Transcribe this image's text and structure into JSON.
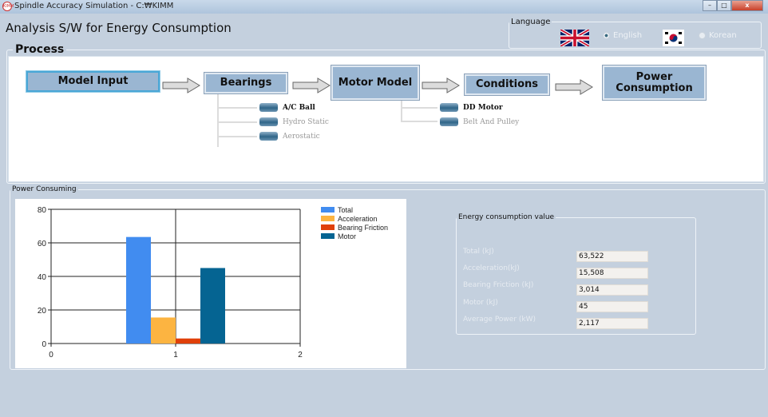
{
  "window": {
    "title": "Spindle Accuracy Simulation -  C:₩KIMM",
    "icon_text": "KIMM",
    "controls": [
      "minimize",
      "maximize",
      "close"
    ],
    "close_label": "x"
  },
  "heading": "Analysis S/W for Energy Consumption",
  "language": {
    "label": "Language",
    "options": [
      {
        "label": "English",
        "selected": true,
        "flag": "uk-flag"
      },
      {
        "label": "Korean",
        "selected": false,
        "flag": "korea-flag"
      }
    ]
  },
  "process": {
    "label": "Process",
    "steps": [
      "Model Input",
      "Bearings",
      "Motor Model",
      "Conditions",
      "Power Consumption"
    ],
    "bearing_options": [
      {
        "label": "A/C Ball",
        "active": true
      },
      {
        "label": "Hydro Static",
        "active": false
      },
      {
        "label": "Aerostatic",
        "active": false
      }
    ],
    "motor_options": [
      {
        "label": "DD Motor",
        "active": true
      },
      {
        "label": "Belt And Pulley",
        "active": false
      }
    ]
  },
  "power": {
    "label": "Power Consuming"
  },
  "chart_data": {
    "type": "bar",
    "x": [
      1
    ],
    "xlim": [
      0,
      2
    ],
    "ylim": [
      0,
      80
    ],
    "xticks": [
      "0",
      "1",
      "2"
    ],
    "yticks": [
      "0",
      "20",
      "40",
      "60",
      "80"
    ],
    "grid": true,
    "legend_position": "right",
    "series": [
      {
        "name": "Total",
        "values": [
          63.5
        ],
        "color": "#418cf0"
      },
      {
        "name": "Acceleration",
        "values": [
          15.5
        ],
        "color": "#fcb441"
      },
      {
        "name": "Bearing Friction",
        "values": [
          3.0
        ],
        "color": "#e0400a"
      },
      {
        "name": "Motor",
        "values": [
          45
        ],
        "color": "#056492"
      }
    ]
  },
  "energy": {
    "label": "Energy consumption value",
    "rows": [
      {
        "label": "Total (kJ)",
        "value": "63,522"
      },
      {
        "label": "Acceleration(kJ)",
        "value": "15,508"
      },
      {
        "label": "Bearing Friction (kJ)",
        "value": "3,014"
      },
      {
        "label": "Motor (kJ)",
        "value": "45"
      },
      {
        "label": "Average Power (kW)",
        "value": "2,117"
      }
    ]
  }
}
